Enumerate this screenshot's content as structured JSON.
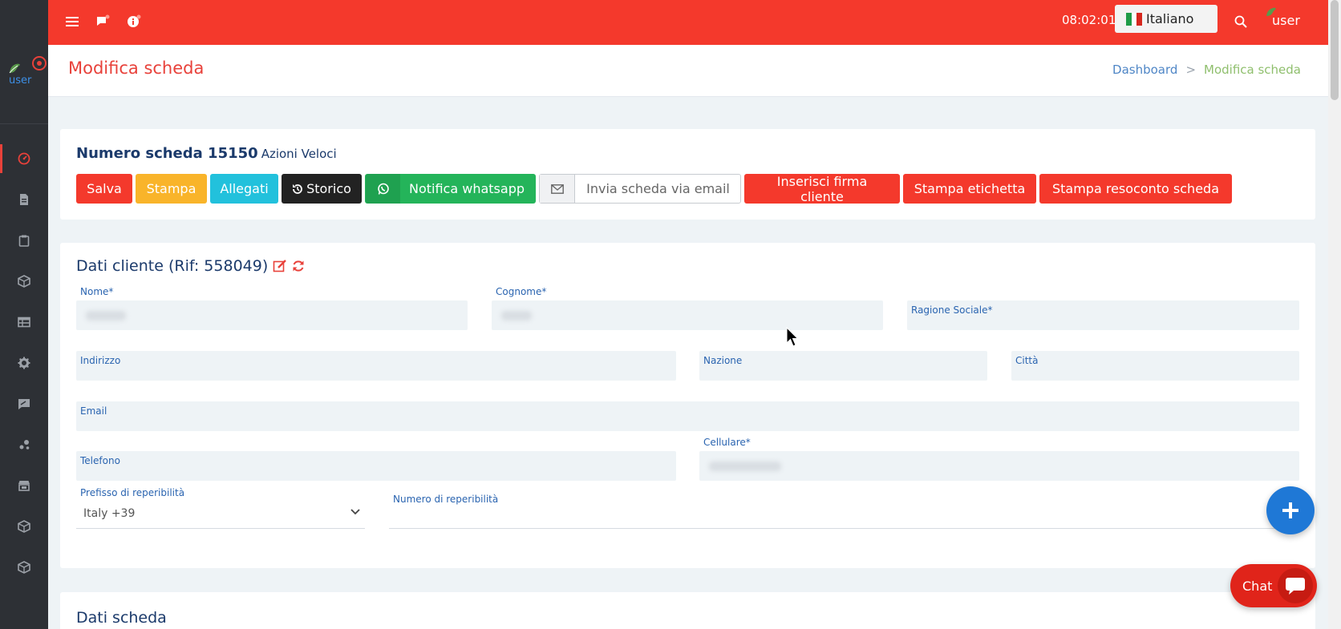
{
  "topbar": {
    "time": "08:02:01",
    "language": "Italiano",
    "user": "user",
    "colors": {
      "accent": "#f4392c"
    }
  },
  "sidebar": {
    "user": "user",
    "items": [
      {
        "icon": "dashboard-icon",
        "active": true
      },
      {
        "icon": "document-icon"
      },
      {
        "icon": "clipboard-icon"
      },
      {
        "icon": "box-icon"
      },
      {
        "icon": "table-icon"
      },
      {
        "icon": "gear-icon"
      },
      {
        "icon": "message-icon"
      },
      {
        "icon": "network-icon"
      },
      {
        "icon": "store-icon"
      },
      {
        "icon": "box-icon"
      },
      {
        "icon": "box-icon"
      }
    ]
  },
  "header": {
    "title": "Modifica scheda",
    "breadcrumb": {
      "home": "Dashboard",
      "separator": ">",
      "current": "Modifica scheda"
    }
  },
  "scheda": {
    "heading": "Numero scheda 15150",
    "subheading": "Azioni Veloci",
    "buttons": {
      "salva": "Salva",
      "stampa": "Stampa",
      "allegati": "Allegati",
      "storico": "Storico",
      "whatsapp": "Notifica whatsapp",
      "email": "Invia scheda via email",
      "firma": "Inserisci firma cliente",
      "etichetta": "Stampa etichetta",
      "resoconto": "Stampa resoconto scheda"
    }
  },
  "cliente": {
    "title": "Dati cliente (Rif: 558049)",
    "fields": {
      "nome": "Nome*",
      "cognome": "Cognome*",
      "ragione_sociale": "Ragione Sociale*",
      "indirizzo": "Indirizzo",
      "nazione": "Nazione",
      "citta": "Città",
      "email": "Email",
      "telefono": "Telefono",
      "cellulare": "Cellulare*",
      "prefisso": "Prefisso di reperibilità",
      "prefisso_value": "Italy +39",
      "numero_reperibilita": "Numero di reperibilità"
    }
  },
  "dati_scheda": {
    "title": "Dati scheda"
  },
  "chat": {
    "label": "Chat"
  }
}
